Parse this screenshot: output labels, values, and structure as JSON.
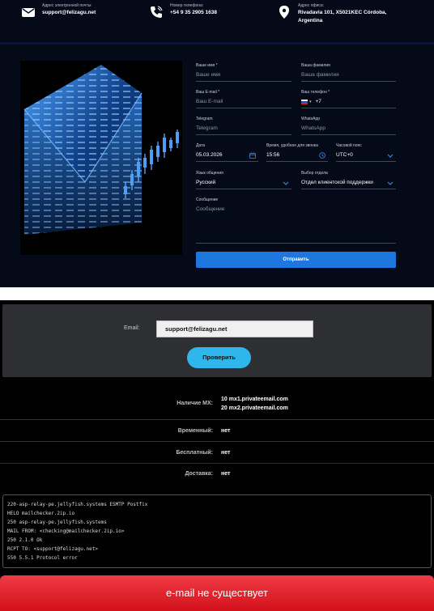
{
  "contacts": {
    "email": {
      "label": "Адрес электронной почты:",
      "value": "support@felizagu.net",
      "icon": "mail-icon"
    },
    "phone": {
      "label": "Номер телефона:",
      "value": "+54 9 35 2905 1638",
      "icon": "phone-icon"
    },
    "address": {
      "label": "Адрес офиса:",
      "value_line1": "Rivadavia 101, X5021KEC Córdoba,",
      "value_line2": "Argentina",
      "icon": "location-pin-icon"
    }
  },
  "form": {
    "first_name": {
      "label": "Ваше имя *",
      "placeholder": "Ваше имя"
    },
    "last_name": {
      "label": "Ваша фамилия",
      "placeholder": "Ваша фамилия"
    },
    "email": {
      "label": "Ваш E-mail *",
      "placeholder": "Ваш E-mail"
    },
    "phone": {
      "label": "Ваш телефон *",
      "prefix": "+7",
      "flag": "russia-flag-icon"
    },
    "telegram": {
      "label": "Telegram",
      "placeholder": "Telegram"
    },
    "whatsapp": {
      "label": "WhatsApp",
      "placeholder": "WhatsApp"
    },
    "date": {
      "label": "Дата",
      "value": "05.03.2026"
    },
    "time": {
      "label": "Время, удобное для звонка",
      "value": "15:56"
    },
    "timezone": {
      "label": "Часовой пояс",
      "value": "UTC+0"
    },
    "language": {
      "label": "Язык общения",
      "value": "Русский"
    },
    "department": {
      "label": "Выбор отдела",
      "value": "Отдел клиентской поддержки"
    },
    "message": {
      "label": "Сообщение",
      "placeholder": "Сообщение"
    },
    "submit_label": "Отправить"
  },
  "checker": {
    "email_label": "Email:",
    "email_value": "support@felizagu.net",
    "check_label": "Проверить",
    "rows": {
      "mx_label": "Наличие MX:",
      "mx_values": [
        "10 mx1.privateemail.com",
        "20 mx2.privateemail.com"
      ],
      "temporary_label": "Временный:",
      "temporary_value": "нет",
      "free_label": "Бесплатный:",
      "free_value": "нет",
      "delivery_label": "Доставка:",
      "delivery_value": "нет"
    },
    "log": [
      "220-asp-relay-pe.jellyfish.systems ESMTP Postfix",
      "HELO mailchecker.2ip.io",
      "250 asp-relay-pe.jellyfish.systems",
      "MAIL FROM: <checking@mailchecker.2ip.io>",
      "250 2.1.0 Ok",
      "RCPT TO: <support@felizagu.net>",
      "550 5.5.1 Protocol error"
    ],
    "result": "e-mail не существует"
  },
  "colors": {
    "accent": "#1e77df",
    "check_button": "#2fb6ea",
    "result_bg": "#e0202c",
    "top_bg": "#050a19"
  }
}
